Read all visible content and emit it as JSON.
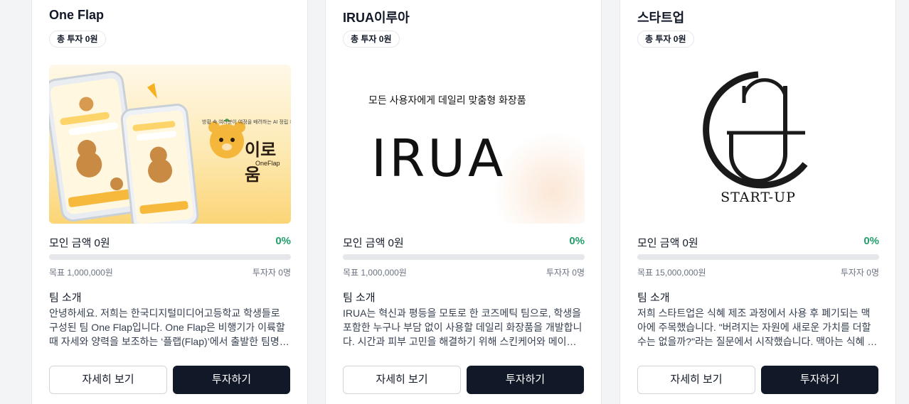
{
  "cards": [
    {
      "title": "One Flap",
      "badge": "총 투자 0원",
      "image": {
        "alt_brand": "이로움",
        "alt_sub": "OneFlap",
        "tagline": "방황 속 여러분이 여정을 배려하는 AI 정립 케어 서"
      },
      "raised": "모인 금액 0원",
      "percent": "0%",
      "progress": 0,
      "goal": "목표 1,000,000원",
      "investors": "투자자 0명",
      "team_heading": "팀 소개",
      "team_desc": "안녕하세요. 저희는 한국디지털미디어고등학교 학생들로 구성된 팀 One Flap입니다. One Flap은 비행기가 이륙할 때 자세와 양력을 보조하는 ‘플랩(Flap)’에서 출발한 팀명입니다.",
      "detail_label": "자세히 보기",
      "invest_label": "투자하기"
    },
    {
      "title": "IRUA이루아",
      "badge": "총 투자 0원",
      "image": {
        "slogan": "모든 사용자에게 데일리 맞춤형 화장품",
        "logo": "IRUA"
      },
      "raised": "모인 금액 0원",
      "percent": "0%",
      "progress": 0,
      "goal": "목표 1,000,000원",
      "investors": "투자자 0명",
      "team_heading": "팀 소개",
      "team_desc": "IRUA는 혁신과 평등을 모토로 한 코즈메틱 팀으로, 학생을 포함한 누구나 부담 없이 사용할 데일리 화장품을 개발합니다. 시간과 피부 고민을 해결하기 위해 스킨케어와 메이크업을",
      "detail_label": "자세히 보기",
      "invest_label": "투자하기"
    },
    {
      "title": "스타트업",
      "badge": "총 투자 0원",
      "image": {
        "wordmark": "START-UP"
      },
      "raised": "모인 금액 0원",
      "percent": "0%",
      "progress": 0,
      "goal": "목표 15,000,000원",
      "investors": "투자자 0명",
      "team_heading": "팀 소개",
      "team_desc": "저희 스타트업은 식혜 제조 과정에서 사용 후 폐기되는 맥아에 주목했습니다. \"버려지는 자원에 새로운 가치를 더할 수는 없을까?\"라는 질문에서 시작했습니다. 맥아는 식혜 제조 후",
      "detail_label": "자세히 보기",
      "invest_label": "투자하기"
    }
  ],
  "colors": {
    "accent_green": "#22a06b",
    "button_dark": "#111827",
    "border": "#e5e7eb"
  }
}
